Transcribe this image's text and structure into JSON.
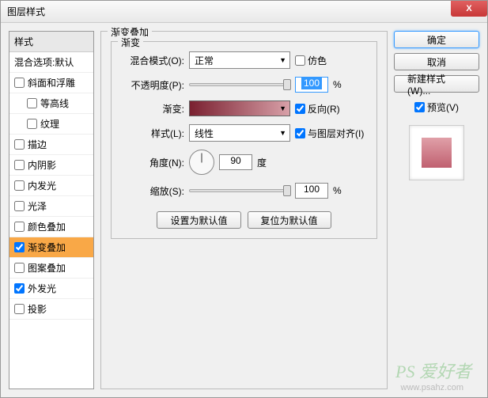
{
  "window": {
    "title": "图层样式",
    "close": "X"
  },
  "sidebar": {
    "header": "样式",
    "blend_options": "混合选项:默认",
    "items": [
      {
        "label": "斜面和浮雕",
        "checked": false,
        "indent": false
      },
      {
        "label": "等高线",
        "checked": false,
        "indent": true
      },
      {
        "label": "纹理",
        "checked": false,
        "indent": true
      },
      {
        "label": "描边",
        "checked": false,
        "indent": false
      },
      {
        "label": "内阴影",
        "checked": false,
        "indent": false
      },
      {
        "label": "内发光",
        "checked": false,
        "indent": false
      },
      {
        "label": "光泽",
        "checked": false,
        "indent": false
      },
      {
        "label": "颜色叠加",
        "checked": false,
        "indent": false
      },
      {
        "label": "渐变叠加",
        "checked": true,
        "indent": false,
        "selected": true
      },
      {
        "label": "图案叠加",
        "checked": false,
        "indent": false
      },
      {
        "label": "外发光",
        "checked": true,
        "indent": false
      },
      {
        "label": "投影",
        "checked": false,
        "indent": false
      }
    ]
  },
  "main": {
    "section_title": "渐变叠加",
    "inner_title": "渐变",
    "blend_mode_label": "混合模式(O):",
    "blend_mode_value": "正常",
    "dither_label": "仿色",
    "opacity_label": "不透明度(P):",
    "opacity_value": "100",
    "opacity_unit": "%",
    "gradient_label": "渐变:",
    "reverse_label": "反向(R)",
    "style_label": "样式(L):",
    "style_value": "线性",
    "align_label": "与图层对齐(I)",
    "angle_label": "角度(N):",
    "angle_value": "90",
    "angle_unit": "度",
    "scale_label": "缩放(S):",
    "scale_value": "100",
    "scale_unit": "%",
    "default_btn": "设置为默认值",
    "reset_btn": "复位为默认值"
  },
  "right": {
    "ok": "确定",
    "cancel": "取消",
    "new_style": "新建样式(W)...",
    "preview_label": "预览(V)"
  },
  "watermark": {
    "logo": "PS 爱好者",
    "url": "www.psahz.com"
  }
}
